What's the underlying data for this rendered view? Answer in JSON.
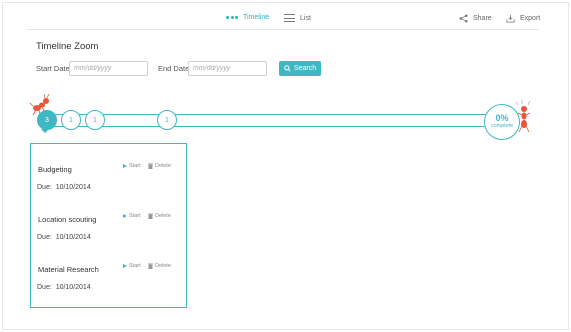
{
  "nav": {
    "timeline_label": "Timeline",
    "list_label": "List",
    "share_label": "Share",
    "export_label": "Export"
  },
  "page": {
    "title": "Timeline Zoom"
  },
  "filters": {
    "start_label": "Start Date",
    "start_placeholder": "mm/dd/yyyy",
    "end_label": "End Date",
    "end_placeholder": "mm/dd/yyyy",
    "search_label": "Search"
  },
  "timeline": {
    "nodes": [
      "3",
      "1",
      "1",
      "1"
    ],
    "progress_value": "0%",
    "progress_label": "complete"
  },
  "tasks": [
    {
      "name": "Budgeting",
      "start": "Start",
      "delete": "Delete",
      "due_label": "Due:",
      "due_date": "10/10/2014"
    },
    {
      "name": "Location scouting",
      "start": "Start",
      "delete": "Delete",
      "due_label": "Due:",
      "due_date": "10/10/2014"
    },
    {
      "name": "Material Research",
      "start": "Start",
      "delete": "Delete",
      "due_label": "Due:",
      "due_date": "10/10/2014"
    }
  ],
  "colors": {
    "accent": "#3fb8c4",
    "mascot": "#e8553a"
  }
}
